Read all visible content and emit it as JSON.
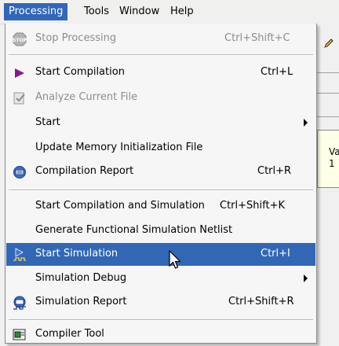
{
  "menubar": {
    "items": [
      {
        "label": "Processing"
      },
      {
        "label": "Tools"
      },
      {
        "label": "Window"
      },
      {
        "label": "Help"
      }
    ]
  },
  "background": {
    "panel_lines": [
      "Va",
      "1"
    ]
  },
  "menu": {
    "items": [
      {
        "label": "Stop Processing",
        "shortcut": "Ctrl+Shift+C",
        "icon": "stop-icon",
        "disabled": true
      },
      {
        "label": "Start Compilation",
        "shortcut": "Ctrl+L",
        "icon": "play-icon"
      },
      {
        "label": "Analyze Current File",
        "shortcut": "",
        "icon": "analyze-file-icon",
        "disabled": true
      },
      {
        "label": "Start",
        "shortcut": "",
        "submenu": true
      },
      {
        "label": "Update Memory Initialization File",
        "shortcut": ""
      },
      {
        "label": "Compilation Report",
        "shortcut": "Ctrl+R",
        "icon": "report-icon"
      },
      {
        "label": "Start Compilation and Simulation",
        "shortcut": "Ctrl+Shift+K"
      },
      {
        "label": "Generate Functional Simulation Netlist",
        "shortcut": ""
      },
      {
        "label": "Start Simulation",
        "shortcut": "Ctrl+I",
        "icon": "simulation-icon",
        "highlighted": true
      },
      {
        "label": "Simulation Debug",
        "shortcut": "",
        "submenu": true
      },
      {
        "label": "Simulation Report",
        "shortcut": "Ctrl+Shift+R",
        "icon": "simulation-report-icon"
      },
      {
        "label": "Compiler Tool",
        "shortcut": "",
        "icon": "compiler-tool-icon"
      }
    ]
  },
  "colors": {
    "highlight": "#3267b6",
    "play_arrow": "#8a1a8a"
  }
}
